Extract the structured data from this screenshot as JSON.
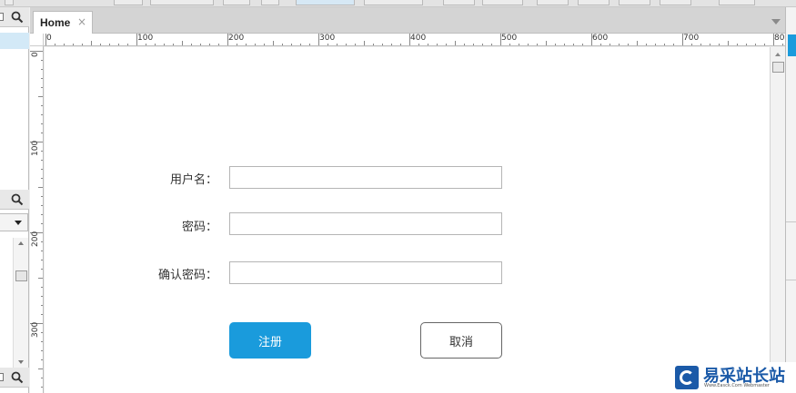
{
  "tab": {
    "label": "Home",
    "close_glyph": "×"
  },
  "ruler": {
    "top_labels": [
      "0",
      "100",
      "200",
      "300",
      "400",
      "500",
      "600",
      "700",
      "80"
    ],
    "left_labels": [
      "0",
      "100",
      "200",
      "300"
    ]
  },
  "form": {
    "username_label": "用户名：",
    "username_value": "",
    "password_label": "密码：",
    "password_value": "",
    "confirm_label": "确认密码：",
    "confirm_value": "",
    "register_button": "注册",
    "cancel_button": "取消"
  },
  "watermark": {
    "title": "易采站长站",
    "subtitle": "Www.Easck.Com Webmaster"
  },
  "colors": {
    "accent": "#1a9bdc",
    "watermark": "#1b5aa8"
  },
  "icons": [
    "search-icon",
    "dropdown-arrow-icon",
    "close-icon",
    "tab-menu-icon",
    "scroll-up-icon",
    "scroll-down-icon"
  ]
}
